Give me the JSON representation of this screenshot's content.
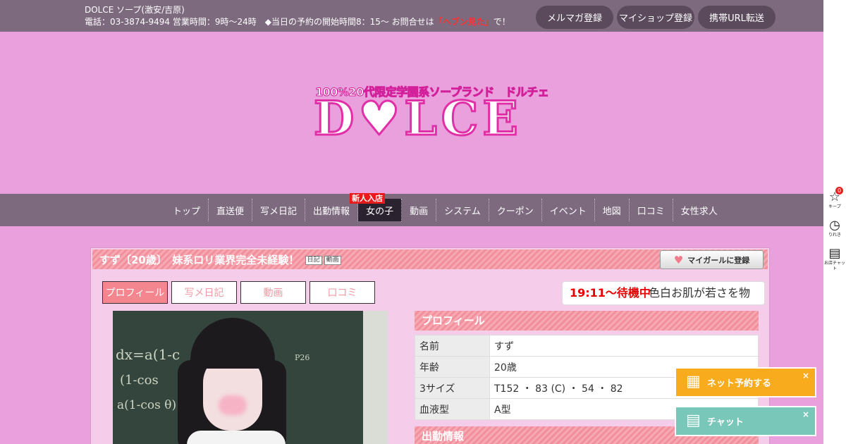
{
  "header": {
    "line1": "DOLCE ソープ(激安/吉原)",
    "line2_pre": "電話：03-3874-9494 営業時間：9時～24時　◆当日の予約の開始時間8：15～ お問合せは",
    "line2_highlight": "「ヘブン見た」",
    "line2_post": "で！",
    "buttons": [
      "メルマガ登録",
      "マイショップ登録",
      "携帯URL転送"
    ]
  },
  "logo": {
    "tagline": "100%20代限定学園系ソープランド　ドルチェ",
    "name": "D♥LCE"
  },
  "nav": {
    "items": [
      "トップ",
      "直送便",
      "写メ日記",
      "出勤情報",
      "女の子",
      "動画",
      "システム",
      "クーポン",
      "イベント",
      "地図",
      "口コミ",
      "女性求人"
    ],
    "badge": "新人入店"
  },
  "profile_panel": {
    "title": "すず〔20歳〕　妹系ロリ業界完全未経験！",
    "badges": [
      "日記",
      "動画"
    ],
    "mygirl_button": "マイガールに登録",
    "tabs": [
      "プロフィール",
      "写メ日記",
      "動画",
      "口コミ"
    ],
    "ticker_status": "19:11～待機中",
    "ticker_message": "色白お肌が若さを物",
    "photo_chalk": [
      "dx=a(1-c",
      "(1-cos",
      "a(1-cos θ)",
      "P26"
    ],
    "section_profile": "プロフィール",
    "section_schedule": "出勤情報",
    "rows": [
      {
        "label": "名前",
        "value": "すず"
      },
      {
        "label": "年齢",
        "value": "20歳"
      },
      {
        "label": "3サイズ",
        "value": "T152 ・ 83 (C) ・ 54 ・ 82"
      },
      {
        "label": "血液型",
        "value": "A型"
      }
    ]
  },
  "sidebar": {
    "keep_label": "キープ",
    "keep_count": "0",
    "history_label": "りれき",
    "chat_label": "お店チャット"
  },
  "floating": {
    "reserve": "ネット予約する",
    "chat": "チャット",
    "close": "×"
  },
  "colors": {
    "page_bg": "#e9a0dd",
    "bar_bg": "#7d6a7e",
    "accent_pink": "#f4868f",
    "status_red": "#e60000",
    "reserve_orange": "#f7ab1d",
    "chat_teal": "#79c7b9"
  }
}
